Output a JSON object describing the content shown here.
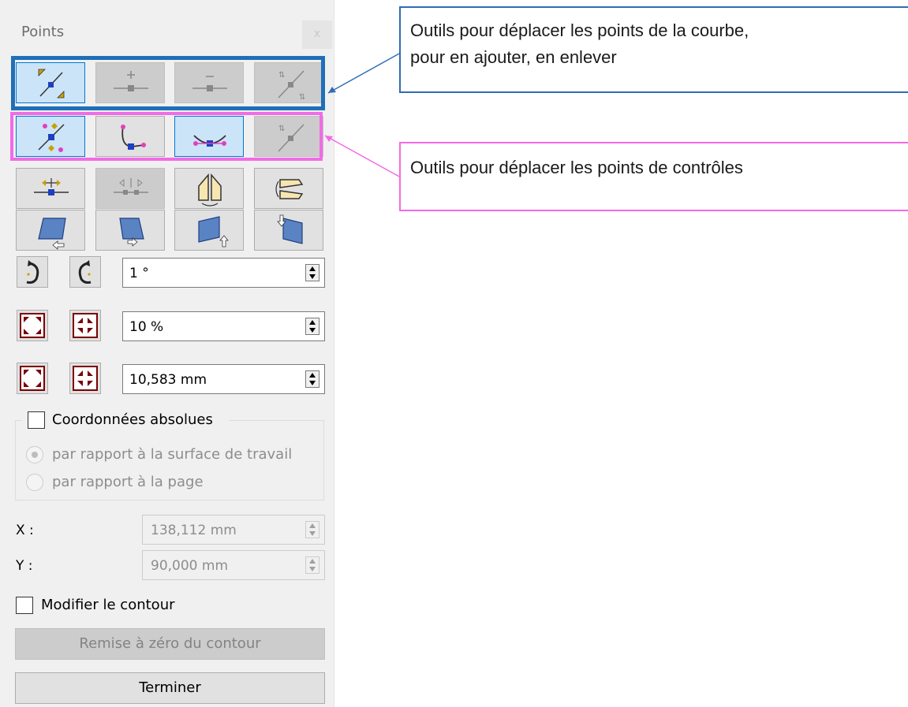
{
  "panel": {
    "title": "Points",
    "close_label": "x",
    "rotation": {
      "value": "1 °"
    },
    "scale_percent": {
      "value": "10 %"
    },
    "scale_mm": {
      "value": "10,583 mm"
    },
    "absolute_coords": {
      "label": "Coordonnées absolues",
      "checked": false,
      "options": [
        "par rapport à la surface de travail",
        "par rapport à la page"
      ],
      "selected": "par rapport à la surface de travail"
    },
    "x": {
      "label": "X :",
      "value": "138,112 mm"
    },
    "y": {
      "label": "Y :",
      "value": "90,000 mm"
    },
    "modify_contour": {
      "label": "Modifier le contour",
      "checked": false
    },
    "reset_contour_label": "Remise à zéro du contour",
    "finish_label": "Terminer"
  },
  "callouts": {
    "curve_points": {
      "line1": "Outils pour déplacer les points de la courbe,",
      "line2": "pour en ajouter, en enlever",
      "color": "#2e6db4"
    },
    "control_points": {
      "line1": "Outils pour déplacer les points de contrôles",
      "color": "#f36ae5"
    }
  },
  "icons": {
    "row1": [
      "move-points-icon",
      "add-point-icon",
      "remove-point-icon",
      "break-point-icon"
    ],
    "row2": [
      "move-control-points-icon",
      "smooth-node-icon",
      "symmetric-node-icon",
      "cusp-node-icon"
    ],
    "row3": [
      "align-horizontal-icon",
      "distribute-horizontal-icon",
      "mirror-vertical-icon",
      "mirror-horizontal-icon"
    ],
    "row4": [
      "skew-left-icon",
      "skew-down-icon",
      "skew-up-icon",
      "skew-right-icon"
    ],
    "rotate": [
      "rotate-ccw-icon",
      "rotate-cw-icon"
    ],
    "scale": [
      "enlarge-icon",
      "shrink-icon"
    ]
  },
  "colors": {
    "highlight_blue": "#1f6fb8",
    "highlight_pink": "#f06ce6",
    "active_tool": "#cce4f7"
  }
}
